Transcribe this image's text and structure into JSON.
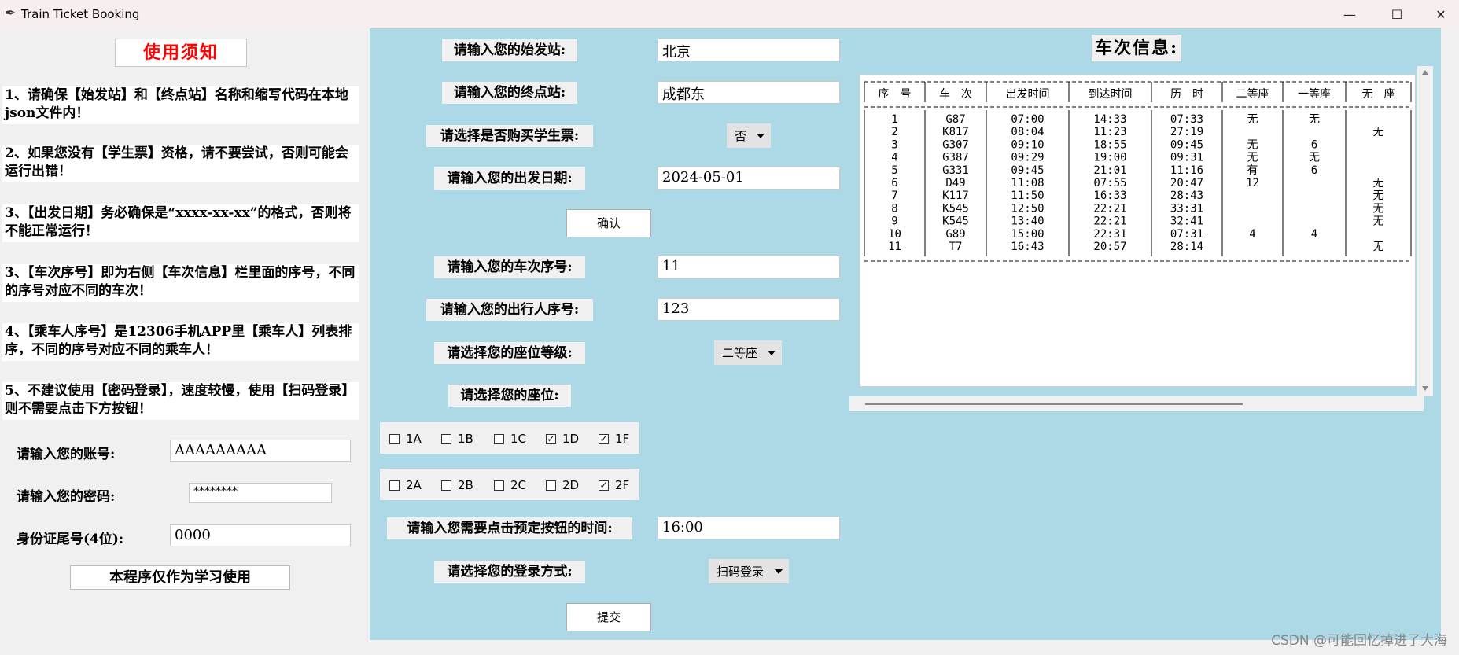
{
  "window": {
    "title": "Train Ticket Booking",
    "controls": {
      "minimize": "—",
      "maximize": "☐",
      "close": "✕"
    }
  },
  "left": {
    "notice_title": "使用须知",
    "notes": [
      "1、请确保【始发站】和【终点站】名称和缩写代码在本地json文件内！",
      "2、如果您没有【学生票】资格，请不要尝试，否则可能会运行出错！",
      "3、【出发日期】务必确保是“xxxx-xx-xx”的格式，否则将不能正常运行！",
      "3、【车次序号】即为右侧【车次信息】栏里面的序号，不同的序号对应不同的车次！",
      "4、【乘车人序号】是12306手机APP里【乘车人】列表排序，不同的序号对应不同的乘车人！",
      "5、不建议使用【密码登录】，速度较慢，使用【扫码登录】则不需要点击下方按钮！"
    ],
    "account_label": "请输入您的账号:",
    "account_value": "AAAAAAAAA",
    "password_label": "请输入您的密码:",
    "password_value": "********",
    "id_label": "身份证尾号(4位):",
    "id_value": "0000",
    "disclaimer": "本程序仅作为学习使用"
  },
  "form": {
    "from_label": "请输入您的始发站:",
    "from_value": "北京",
    "to_label": "请输入您的终点站:",
    "to_value": "成都东",
    "student_label": "请选择是否购买学生票:",
    "student_value": "否",
    "date_label": "请输入您的出发日期:",
    "date_value": "2024-05-01",
    "confirm_button": "确认",
    "train_no_label": "请输入您的车次序号:",
    "train_no_value": "11",
    "passenger_label": "请输入您的出行人序号:",
    "passenger_value": "123",
    "seat_class_label": "请选择您的座位等级:",
    "seat_class_value": "二等座",
    "seat_label": "请选择您的座位:",
    "seats_row1": [
      {
        "label": "1A",
        "checked": false
      },
      {
        "label": "1B",
        "checked": false
      },
      {
        "label": "1C",
        "checked": false
      },
      {
        "label": "1D",
        "checked": true
      },
      {
        "label": "1F",
        "checked": true
      }
    ],
    "seats_row2": [
      {
        "label": "2A",
        "checked": false
      },
      {
        "label": "2B",
        "checked": false
      },
      {
        "label": "2C",
        "checked": false
      },
      {
        "label": "2D",
        "checked": false
      },
      {
        "label": "2F",
        "checked": true
      }
    ],
    "click_time_label": "请输入您需要点击预定按钮的时间:",
    "click_time_value": "16:00",
    "login_label": "请选择您的登录方式:",
    "login_value": "扫码登录",
    "submit_button": "提交"
  },
  "trains": {
    "title": "车次信息:",
    "headers": [
      "序　号",
      "车　次",
      "出发时间",
      "到达时间",
      "历　时",
      "二等座",
      "一等座",
      "无　座"
    ],
    "rows": [
      [
        "1",
        "G87",
        "07:00",
        "14:33",
        "07:33",
        "无",
        "无",
        ""
      ],
      [
        "2",
        "K817",
        "08:04",
        "11:23",
        "27:19",
        "",
        "",
        "无"
      ],
      [
        "3",
        "G307",
        "09:10",
        "18:55",
        "09:45",
        "无",
        "6",
        ""
      ],
      [
        "4",
        "G387",
        "09:29",
        "19:00",
        "09:31",
        "无",
        "无",
        ""
      ],
      [
        "5",
        "G331",
        "09:45",
        "21:01",
        "11:16",
        "有",
        "6",
        ""
      ],
      [
        "6",
        "D49",
        "11:08",
        "07:55",
        "20:47",
        "12",
        "",
        "无"
      ],
      [
        "7",
        "K117",
        "11:50",
        "16:33",
        "28:43",
        "",
        "",
        "无"
      ],
      [
        "8",
        "K545",
        "12:50",
        "22:21",
        "33:31",
        "",
        "",
        "无"
      ],
      [
        "9",
        "K545",
        "13:40",
        "22:21",
        "32:41",
        "",
        "",
        "无"
      ],
      [
        "10",
        "G89",
        "15:00",
        "22:31",
        "07:31",
        "4",
        "4",
        ""
      ],
      [
        "11",
        "T7",
        "16:43",
        "20:57",
        "28:14",
        "",
        "",
        "无"
      ]
    ]
  },
  "watermark": "CSDN @可能回忆掉进了大海"
}
